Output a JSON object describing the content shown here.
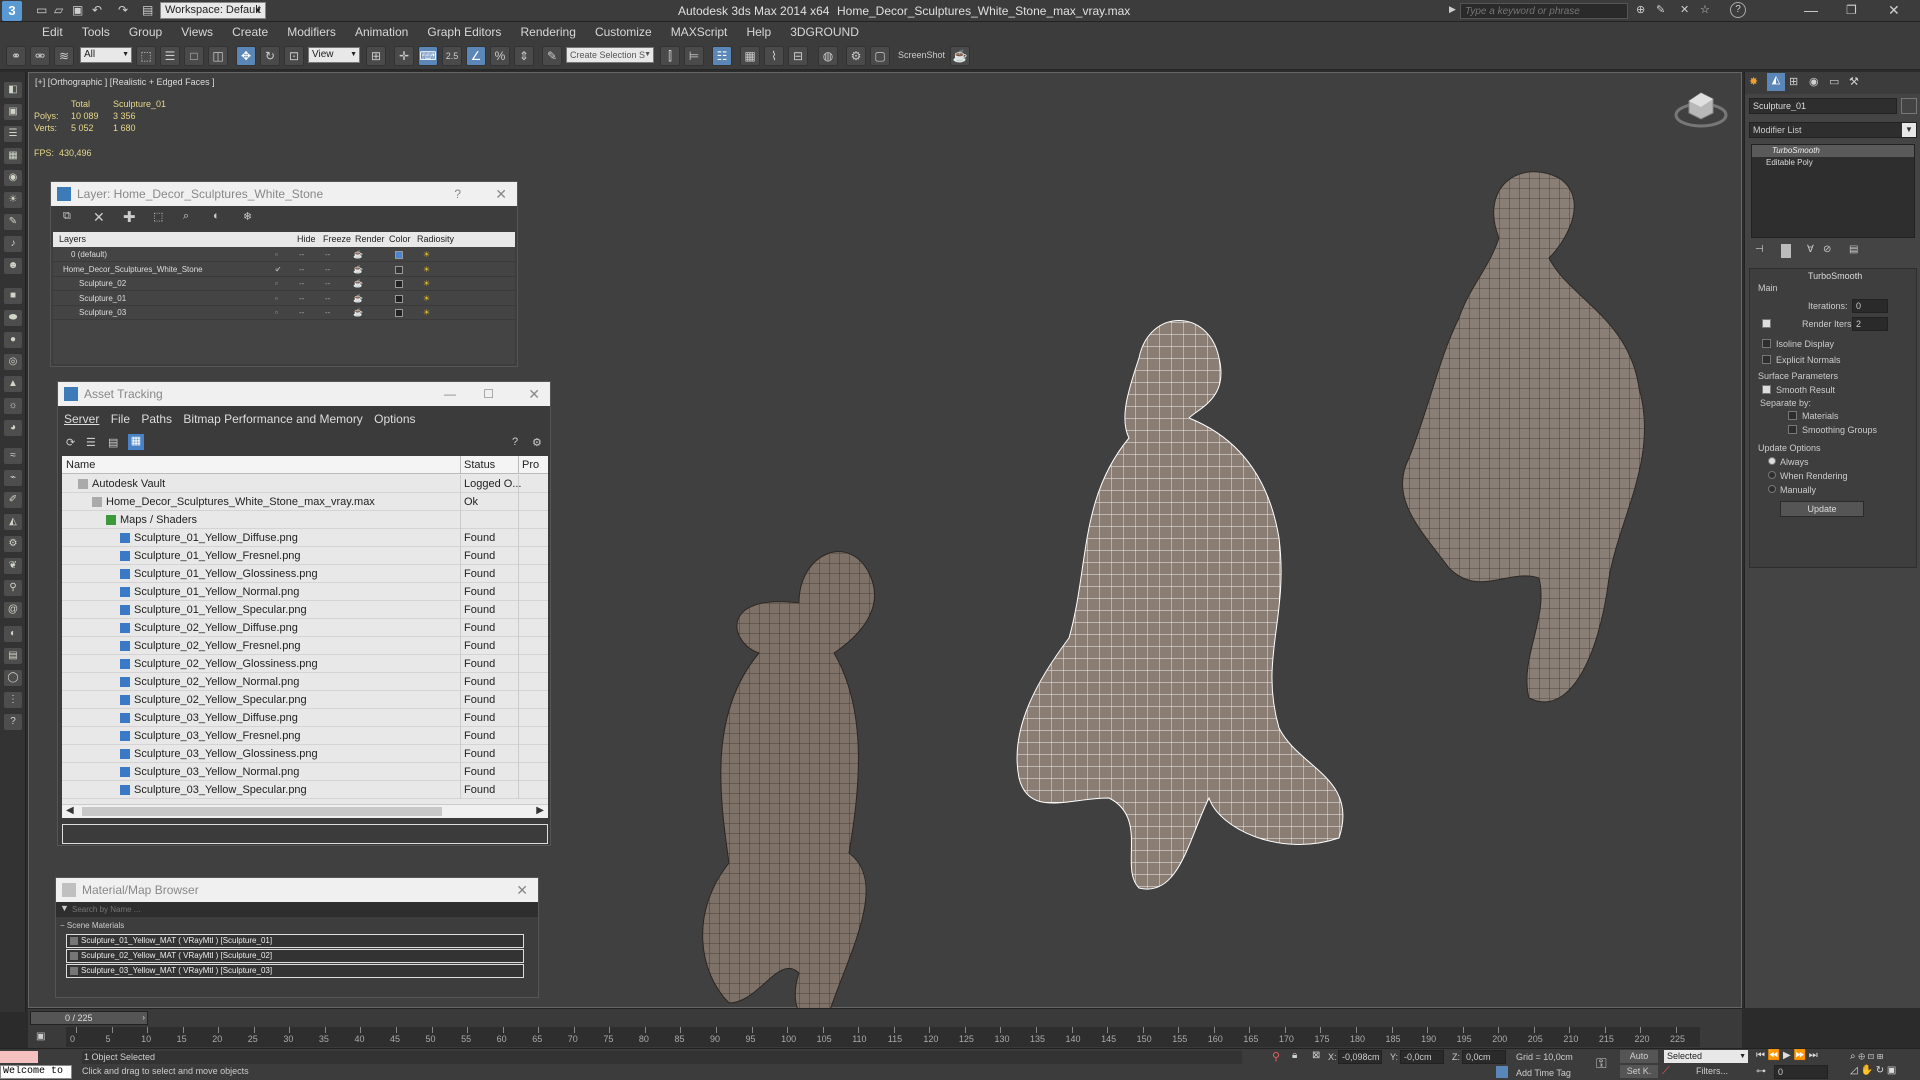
{
  "titlebar": {
    "workspace": "Workspace: Default",
    "app_title": "Autodesk 3ds Max  2014 x64",
    "file_title": "Home_Decor_Sculptures_White_Stone_max_vray.max",
    "search_placeholder": "Type a keyword or phrase"
  },
  "menu": [
    "Edit",
    "Tools",
    "Group",
    "Views",
    "Create",
    "Modifiers",
    "Animation",
    "Graph Editors",
    "Rendering",
    "Customize",
    "MAXScript",
    "Help",
    "3DGROUND"
  ],
  "toolbar": {
    "selection_filter": "All",
    "ref_coord": "View",
    "named_selection": "Create Selection S",
    "snap_label": "2.5",
    "screenshot_label": "ScreenShot"
  },
  "viewport": {
    "label": "[+] [Orthographic ] [Realistic + Edged Faces ]",
    "stats_header_total": "Total",
    "stats_header_obj": "Sculpture_01",
    "polys_label": "Polys:",
    "polys_total": "10 089",
    "polys_obj": "3 356",
    "verts_label": "Verts:",
    "verts_total": "5 052",
    "verts_obj": "1 680",
    "fps_label": "FPS:",
    "fps_value": "430,496"
  },
  "layer_dialog": {
    "title": "Layer: Home_Decor_Sculptures_White_Stone",
    "help": "?",
    "columns": [
      "Layers",
      "Hide",
      "Freeze",
      "Render",
      "Color",
      "Radiosity"
    ],
    "rows": [
      {
        "name": "0 (default)",
        "indent": 1,
        "color": "#4a84d4"
      },
      {
        "name": "Home_Decor_Sculptures_White_Stone",
        "indent": 0,
        "color": "#333333"
      },
      {
        "name": "Sculpture_02",
        "indent": 2,
        "color": "#222222"
      },
      {
        "name": "Sculpture_01",
        "indent": 2,
        "color": "#222222"
      },
      {
        "name": "Sculpture_03",
        "indent": 2,
        "color": "#222222"
      }
    ]
  },
  "asset_tracking": {
    "title": "Asset Tracking",
    "menu": [
      "Server",
      "File",
      "Paths",
      "Bitmap Performance and Memory",
      "Options"
    ],
    "columns": [
      "Name",
      "Status",
      "Pro"
    ],
    "rows": [
      {
        "name": "Autodesk Vault",
        "status": "Logged O...",
        "indent": 1
      },
      {
        "name": "Home_Decor_Sculptures_White_Stone_max_vray.max",
        "status": "Ok",
        "indent": 2
      },
      {
        "name": "Maps / Shaders",
        "status": "",
        "indent": 3
      },
      {
        "name": "Sculpture_01_Yellow_Diffuse.png",
        "status": "Found",
        "indent": 4
      },
      {
        "name": "Sculpture_01_Yellow_Fresnel.png",
        "status": "Found",
        "indent": 4
      },
      {
        "name": "Sculpture_01_Yellow_Glossiness.png",
        "status": "Found",
        "indent": 4
      },
      {
        "name": "Sculpture_01_Yellow_Normal.png",
        "status": "Found",
        "indent": 4
      },
      {
        "name": "Sculpture_01_Yellow_Specular.png",
        "status": "Found",
        "indent": 4
      },
      {
        "name": "Sculpture_02_Yellow_Diffuse.png",
        "status": "Found",
        "indent": 4
      },
      {
        "name": "Sculpture_02_Yellow_Fresnel.png",
        "status": "Found",
        "indent": 4
      },
      {
        "name": "Sculpture_02_Yellow_Glossiness.png",
        "status": "Found",
        "indent": 4
      },
      {
        "name": "Sculpture_02_Yellow_Normal.png",
        "status": "Found",
        "indent": 4
      },
      {
        "name": "Sculpture_02_Yellow_Specular.png",
        "status": "Found",
        "indent": 4
      },
      {
        "name": "Sculpture_03_Yellow_Diffuse.png",
        "status": "Found",
        "indent": 4
      },
      {
        "name": "Sculpture_03_Yellow_Fresnel.png",
        "status": "Found",
        "indent": 4
      },
      {
        "name": "Sculpture_03_Yellow_Glossiness.png",
        "status": "Found",
        "indent": 4
      },
      {
        "name": "Sculpture_03_Yellow_Normal.png",
        "status": "Found",
        "indent": 4
      },
      {
        "name": "Sculpture_03_Yellow_Specular.png",
        "status": "Found",
        "indent": 4
      }
    ]
  },
  "material_browser": {
    "title": "Material/Map Browser",
    "search_placeholder": "Search by Name ...",
    "group": "Scene Materials",
    "items": [
      "Sculpture_01_Yellow_MAT ( VRayMtl ) [Sculpture_01]",
      "Sculpture_02_Yellow_MAT ( VRayMtl ) [Sculpture_02]",
      "Sculpture_03_Yellow_MAT ( VRayMtl ) [Sculpture_03]"
    ]
  },
  "command_panel": {
    "object_name": "Sculpture_01",
    "modifier_list": "Modifier List",
    "stack": [
      "TurboSmooth",
      "Editable Poly"
    ],
    "rollout_title": "TurboSmooth",
    "main_label": "Main",
    "iterations_label": "Iterations:",
    "iterations_value": "0",
    "render_iters_label": "Render Iters:",
    "render_iters_value": "2",
    "isoline": "Isoline Display",
    "explicit_normals": "Explicit Normals",
    "surface_params": "Surface Parameters",
    "smooth_result": "Smooth Result",
    "separate_by": "Separate by:",
    "materials": "Materials",
    "smoothing_groups": "Smoothing Groups",
    "update_options": "Update Options",
    "always": "Always",
    "when_rendering": "When Rendering",
    "manually": "Manually",
    "update_button": "Update"
  },
  "timeline": {
    "frame": "0 / 225",
    "ticks": [
      "0",
      "5",
      "10",
      "15",
      "20",
      "25",
      "30",
      "35",
      "40",
      "45",
      "50",
      "55",
      "60",
      "65",
      "70",
      "75",
      "80",
      "85",
      "90",
      "95",
      "100",
      "105",
      "110",
      "115",
      "120",
      "125",
      "130",
      "135",
      "140",
      "145",
      "150",
      "155",
      "160",
      "165",
      "170",
      "175",
      "180",
      "185",
      "190",
      "195",
      "200",
      "205",
      "210",
      "215",
      "220",
      "225"
    ]
  },
  "status": {
    "welcome": "Welcome to",
    "selected": "1 Object Selected",
    "hint": "Click and drag to select and move objects",
    "x_label": "X:",
    "x_value": "-0,098cm",
    "y_label": "Y:",
    "y_value": "-0,0cm",
    "z_label": "Z:",
    "z_value": "0,0cm",
    "grid": "Grid = 10,0cm",
    "auto": "Auto",
    "set_key": "Set K.",
    "selected_dropdown": "Selected",
    "filters": "Filters...",
    "add_time_tag": "Add Time Tag",
    "frame_value": "0"
  }
}
